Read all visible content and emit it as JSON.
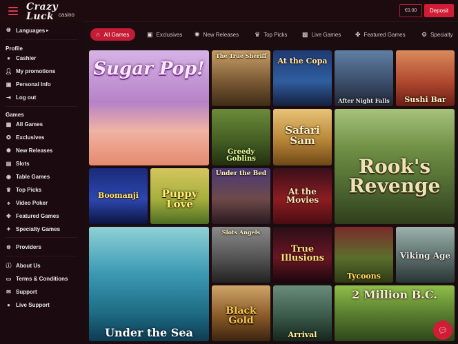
{
  "header": {
    "logo_main": "Crazy Luck",
    "logo_sub": "casino",
    "balance": "€0.00",
    "deposit_label": "Deposit"
  },
  "sidebar": {
    "languages": "Languages",
    "profile_heading": "Profile",
    "profile_items": [
      {
        "label": "Cashier",
        "icon": "coin-icon"
      },
      {
        "label": "My promotions",
        "icon": "person-icon"
      },
      {
        "label": "Personal Info",
        "icon": "person-card-icon"
      },
      {
        "label": "Log out",
        "icon": "logout-icon"
      }
    ],
    "games_heading": "Games",
    "games_items": [
      {
        "label": "All Games",
        "icon": "grid-icon"
      },
      {
        "label": "Exclusives",
        "icon": "star-icon"
      },
      {
        "label": "New Releases",
        "icon": "new-icon"
      },
      {
        "label": "Slots",
        "icon": "slots-icon"
      },
      {
        "label": "Table Games",
        "icon": "table-icon"
      },
      {
        "label": "Top Picks",
        "icon": "trophy-icon"
      },
      {
        "label": "Video Poker",
        "icon": "cards-icon"
      },
      {
        "label": "Featured Games",
        "icon": "featured-icon"
      },
      {
        "label": "Specialty Games",
        "icon": "specialty-icon"
      }
    ],
    "providers": "Providers",
    "support_items": [
      {
        "label": "About Us",
        "icon": "info-icon"
      },
      {
        "label": "Terms & Conditions",
        "icon": "document-icon"
      },
      {
        "label": "Support",
        "icon": "mail-icon"
      },
      {
        "label": "Live Support",
        "icon": "chat-icon"
      }
    ]
  },
  "tabs": [
    {
      "label": "All Games",
      "icon": "horseshoe-icon",
      "active": true
    },
    {
      "label": "Exclusives",
      "icon": "exclusive-icon",
      "active": false
    },
    {
      "label": "New Releases",
      "icon": "new-icon",
      "active": false
    },
    {
      "label": "Top Picks",
      "icon": "trophy-icon",
      "active": false
    },
    {
      "label": "Live Games",
      "icon": "live-icon",
      "active": false
    },
    {
      "label": "Featured Games",
      "icon": "featured-icon",
      "active": false
    },
    {
      "label": "Specialty",
      "icon": "gear-icon",
      "active": false
    }
  ],
  "games": [
    {
      "title": "Sugar Pop!",
      "bg": "#c9a1d6"
    },
    {
      "title": "The True Sheriff",
      "bg": "#5f4a2c"
    },
    {
      "title": "At the Copa",
      "bg": "#3b5a8a"
    },
    {
      "title": "After Night Falls",
      "bg": "#384a66"
    },
    {
      "title": "Sushi Bar",
      "bg": "#b8533a"
    },
    {
      "title": "Greedy Goblins",
      "bg": "#3e5622"
    },
    {
      "title": "Safari Sam",
      "bg": "#a9792f"
    },
    {
      "title": "Rook's Revenge",
      "bg": "#6c7f3a"
    },
    {
      "title": "Boomanji",
      "bg": "#27327a"
    },
    {
      "title": "Puppy Love",
      "bg": "#a6b64a"
    },
    {
      "title": "Under the Bed",
      "bg": "#3b2e5a"
    },
    {
      "title": "At the Movies",
      "bg": "#8c1d22"
    },
    {
      "title": "Under the Sea",
      "bg": "#2b6e86"
    },
    {
      "title": "Slots Angels",
      "bg": "#4a4a4a"
    },
    {
      "title": "True Illusions",
      "bg": "#5b1622"
    },
    {
      "title": "Tycoons",
      "bg": "#5b6f2c"
    },
    {
      "title": "Viking Age",
      "bg": "#3a4e4c"
    },
    {
      "title": "Black Gold",
      "bg": "#7b4e22"
    },
    {
      "title": "Arrival",
      "bg": "#2f4a3c"
    },
    {
      "title": "2 Million B.C.",
      "bg": "#4a6630"
    }
  ],
  "chat_icon": "chat-bubble-icon"
}
